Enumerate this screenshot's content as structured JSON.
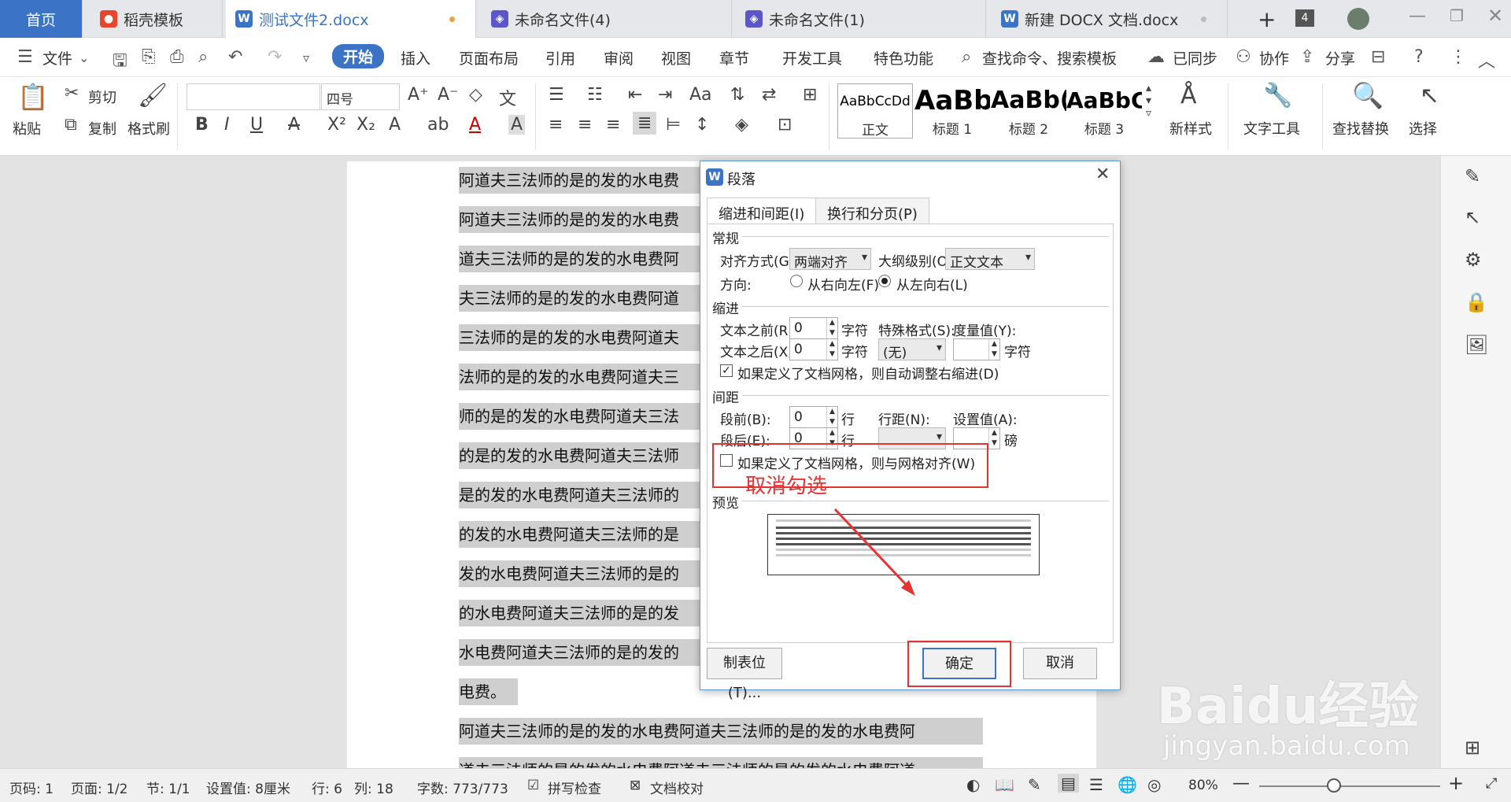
{
  "tabs": [
    {
      "label": "首页"
    },
    {
      "label": "稻壳模板"
    },
    {
      "label": "测试文件2.docx"
    },
    {
      "label": "未命名文件(4)"
    },
    {
      "label": "未命名文件(1)"
    },
    {
      "label": "新建 DOCX 文档.docx"
    }
  ],
  "tab_count": "4",
  "menu": {
    "file": "文件",
    "items": [
      "开始",
      "插入",
      "页面布局",
      "引用",
      "审阅",
      "视图",
      "章节",
      "开发工具",
      "特色功能"
    ],
    "search": "查找命令、搜索模板",
    "sync": "已同步",
    "collab": "协作",
    "share": "分享"
  },
  "ribbon": {
    "paste": "粘贴",
    "cut": "剪切",
    "copy": "复制",
    "format_painter": "格式刷",
    "font_size": "四号",
    "styles": [
      {
        "preview": "AaBbCcDd",
        "label": "正文"
      },
      {
        "preview": "AaBb",
        "label": "标题 1"
      },
      {
        "preview": "AaBb(",
        "label": "标题 2"
      },
      {
        "preview": "AaBbC",
        "label": "标题 3"
      }
    ],
    "new_style": "新样式",
    "text_tools": "文字工具",
    "find_replace": "查找替换",
    "select": "选择"
  },
  "document": {
    "lines": [
      "阿道夫三法师的是的发的水电费",
      "阿道夫三法师的是的发的水电费",
      "道夫三法师的是的发的水电费阿",
      "夫三法师的是的发的水电费阿道",
      "三法师的是的发的水电费阿道夫",
      "法师的是的发的水电费阿道夫三",
      "师的是的发的水电费阿道夫三法",
      "的是的发的水电费阿道夫三法师",
      "是的发的水电费阿道夫三法师的",
      "的发的水电费阿道夫三法师的是",
      "发的水电费阿道夫三法师的是的",
      "的水电费阿道夫三法师的是的发",
      "水电费阿道夫三法师的是的发的",
      "电费。",
      "阿道夫三法师的是的发的水电费阿道夫三法师的是的发的水电费阿",
      "道夫三法师的是的发的水电费阿道夫三法师的是的发的水电费阿道"
    ]
  },
  "dialog": {
    "title": "段落",
    "tab_indent_spacing": "缩进和间距(I)",
    "tab_line_page": "换行和分页(P)",
    "general": "常规",
    "alignment_label": "对齐方式(G):",
    "alignment_value": "两端对齐",
    "outline_label": "大纲级别(O):",
    "outline_value": "正文文本",
    "direction_label": "方向:",
    "rtl": "从右向左(F)",
    "ltr": "从左向右(L)",
    "indent": "缩进",
    "before_text_label": "文本之前(R):",
    "before_text_value": "0",
    "char_unit": "字符",
    "special_label": "特殊格式(S):",
    "special_value": "(无)",
    "measure_label": "度量值(Y):",
    "after_text_label": "文本之后(X):",
    "after_text_value": "0",
    "auto_indent_check": "如果定义了文档网格，则自动调整右缩进(D)",
    "spacing": "间距",
    "before_label": "段前(B):",
    "before_value": "0",
    "line_unit": "行",
    "line_spacing_label": "行距(N):",
    "set_value_label": "设置值(A):",
    "after_label": "段后(E):",
    "after_value": "0",
    "pound_unit": "磅",
    "grid_check": "如果定义了文档网格，则与网格对齐(W)",
    "annotation": "取消勾选",
    "preview": "预览",
    "tabs_button": "制表位(T)...",
    "ok": "确定",
    "cancel": "取消"
  },
  "status": {
    "page_num": "页码: 1",
    "pages": "页面: 1/2",
    "section": "节: 1/1",
    "setting": "设置值: 8厘米",
    "row": "行: 6",
    "col": "列: 18",
    "words": "字数: 773/773",
    "spell": "拼写检查",
    "proof": "文档校对",
    "zoom": "80%"
  },
  "watermark": {
    "brand": "Baidu经验",
    "url": "jingyan.baidu.com"
  },
  "colors": {
    "accent": "#3b73c6",
    "annotation_red": "#e53333"
  }
}
